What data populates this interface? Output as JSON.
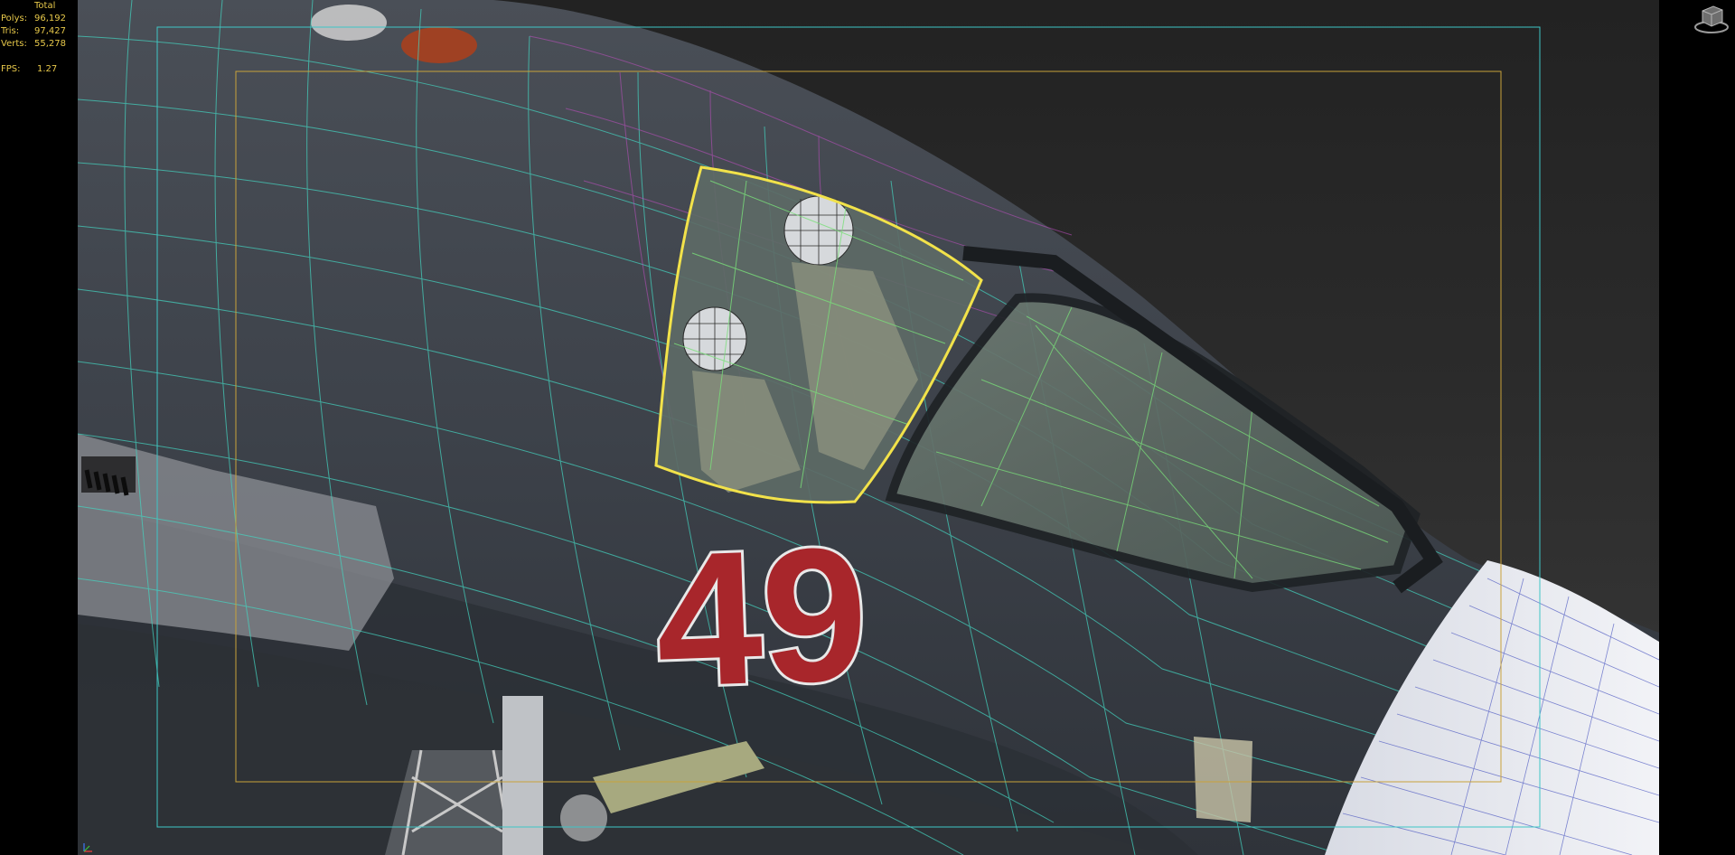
{
  "stats": {
    "header": "Total",
    "rows": [
      {
        "label": "Polys:",
        "value": "96,192",
        "selected": "0"
      },
      {
        "label": "Tris:",
        "value": "97,427",
        "selected": "0"
      },
      {
        "label": "Verts:",
        "value": "55,278",
        "selected": "0"
      }
    ],
    "fps_label": "FPS:",
    "fps_value": "1.27"
  },
  "aircraft": {
    "tail_number": "49"
  },
  "viewport": {
    "icons": {
      "viewcube": "viewcube-icon",
      "axis": "axis-tripod-icon"
    }
  },
  "colors": {
    "stat_text": "#e7c84a",
    "safe_frame_outer": "#3ec6c6",
    "safe_frame_inner": "#c9a23a",
    "selection": "#f2e24a",
    "wire_cyan": "#44d6c2",
    "wire_magenta": "#c24fc4",
    "wire_green": "#7ae07a",
    "numeral_red": "#a8262b"
  }
}
